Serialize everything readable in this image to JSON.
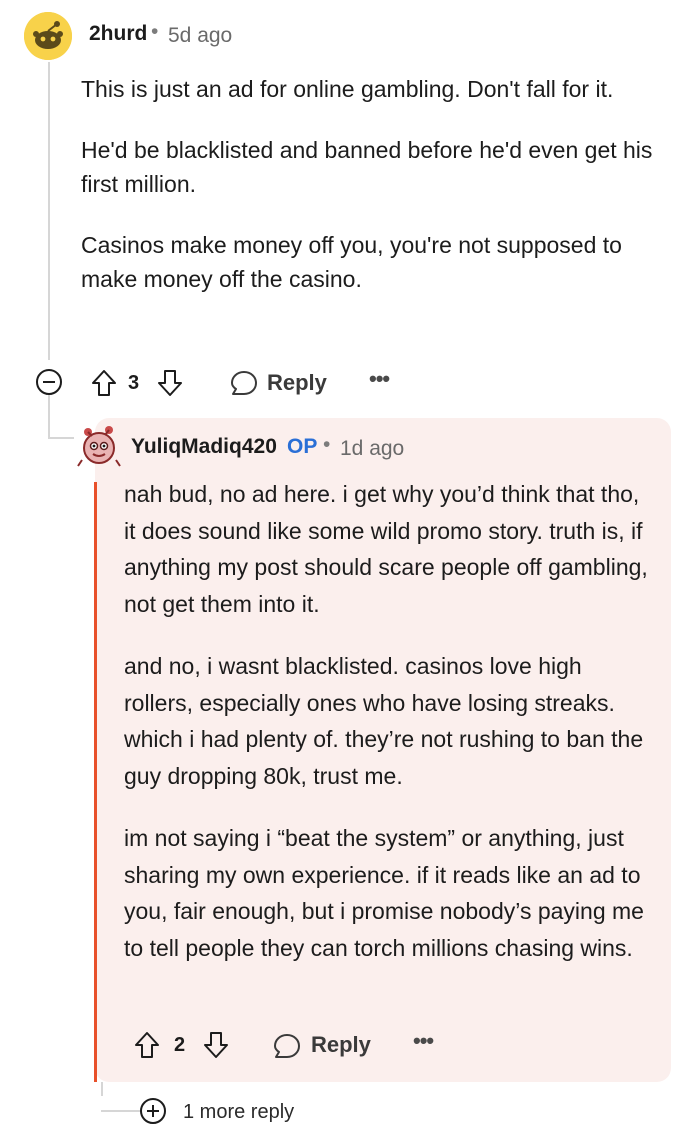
{
  "top_comment": {
    "username": "2hurd",
    "separator": "•",
    "time": "5d ago",
    "paragraphs": [
      "This is just an ad for online gambling. Don't fall for it.",
      "He'd be blacklisted and banned before he'd even get his first million.",
      "Casinos make money off you, you're not supposed to make money off the casino."
    ],
    "score": "3",
    "reply_label": "Reply",
    "more_label": "•••"
  },
  "reply_comment": {
    "username": "YuliqMadiq420",
    "op_badge": "OP",
    "separator": "•",
    "time": "1d ago",
    "paragraphs": [
      "nah bud, no ad here. i get why you’d think that tho, it does sound like some wild promo story. truth is, if anything my post should scare people off gambling, not get them into it.",
      "and no, i wasnt blacklisted. casinos love high rollers, especially ones who have losing streaks. which i had plenty of. they’re not rushing to ban the guy dropping 80k, trust me.",
      "im not saying i “beat the system” or anything, just sharing my own experience. if it reads like an ad to you, fair enough, but i promise nobody’s paying me to tell people they can torch millions chasing wins."
    ],
    "score": "2",
    "reply_label": "Reply",
    "more_label": "•••"
  },
  "more_replies": {
    "label": "1 more reply"
  },
  "colors": {
    "op_badge": "#2a6fd6",
    "highlight_bar": "#e8502a",
    "reply_card_bg": "#fbefed",
    "avatar_top_bg": "#f8d24a"
  }
}
